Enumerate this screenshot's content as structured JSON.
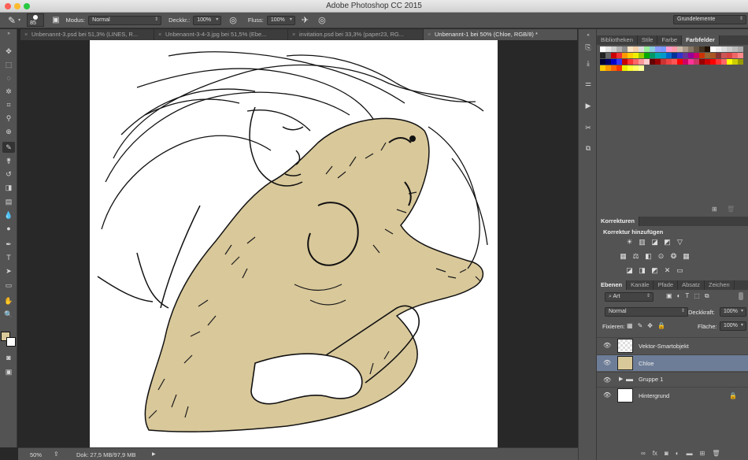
{
  "app": {
    "title": "Adobe Photoshop CC 2015"
  },
  "options": {
    "brush_size": "85",
    "mode_label": "Modus:",
    "mode_value": "Normal",
    "opacity_label": "Deckkr.:",
    "opacity_value": "100%",
    "flow_label": "Fluss:",
    "flow_value": "100%",
    "workspace": "Grundelemente"
  },
  "tabs": [
    {
      "label": "Unbenannt-3.psd bei 51,3% (LINES, R..."
    },
    {
      "label": "Unbenannt-3-4-3.jpg bei 51,5% (Ebe..."
    },
    {
      "label": "invitation.psd bei 33,3% (paper23, RG..."
    },
    {
      "label": "Unbenannt-1 bei 50% (Chloe, RGB/8) *"
    }
  ],
  "status": {
    "zoom": "50%",
    "doc": "Dok: 27,5 MB/97,9 MB"
  },
  "swatch_panel": {
    "tabs": [
      "Bibliotheken",
      "Stile",
      "Farbe",
      "Farbfelder"
    ]
  },
  "adjustments": {
    "tab": "Korrekturen",
    "heading": "Korrektur hinzufügen"
  },
  "layers_panel": {
    "tabs": [
      "Ebenen",
      "Kanäle",
      "Pfade",
      "Absatz",
      "Zeichen"
    ],
    "filter": "Art",
    "blend_mode": "Normal",
    "opacity_label": "Deckkraft:",
    "opacity_value": "100%",
    "lock_label": "Fixieren:",
    "fill_label": "Fläche:",
    "fill_value": "100%",
    "layers": [
      {
        "name": "Vektor-Smartobjekt"
      },
      {
        "name": "Chloe"
      },
      {
        "name": "Gruppe 1"
      },
      {
        "name": "Hintergrund"
      }
    ]
  },
  "colors": {
    "fill": "#d9c89a",
    "line": "#111111",
    "selection": "#6d7d98"
  }
}
